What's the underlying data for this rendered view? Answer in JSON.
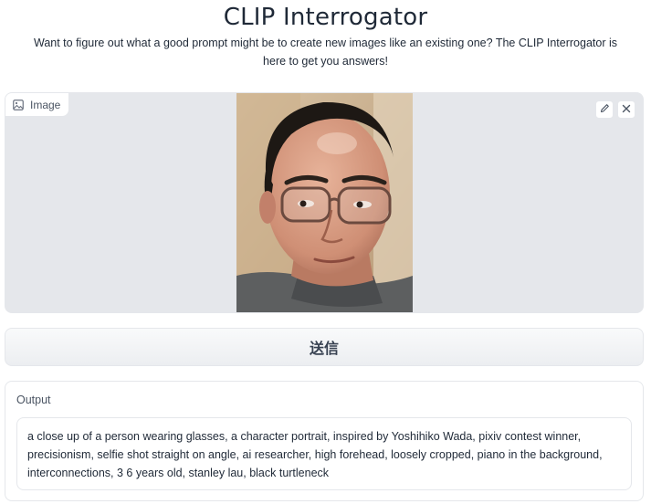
{
  "header": {
    "title": "CLIP Interrogator",
    "subtitle": "Want to figure out what a good prompt might be to create new images like an existing one? The CLIP Interrogator is here to get you answers!"
  },
  "image_input": {
    "label": "Image",
    "label_icon": "image-icon",
    "edit_icon": "pencil-icon",
    "clear_icon": "close-icon",
    "colors": {
      "panel_bg": "#e5e7eb"
    }
  },
  "submit": {
    "label": "送信"
  },
  "output": {
    "label": "Output",
    "value": "a close up of a person wearing glasses, a character portrait, inspired by Yoshihiko Wada, pixiv contest winner, precisionism, selfie shot straight on angle, ai researcher, high forehead, loosely cropped, piano in the background, interconnections, 3 6 years old, stanley lau, black turtleneck"
  }
}
